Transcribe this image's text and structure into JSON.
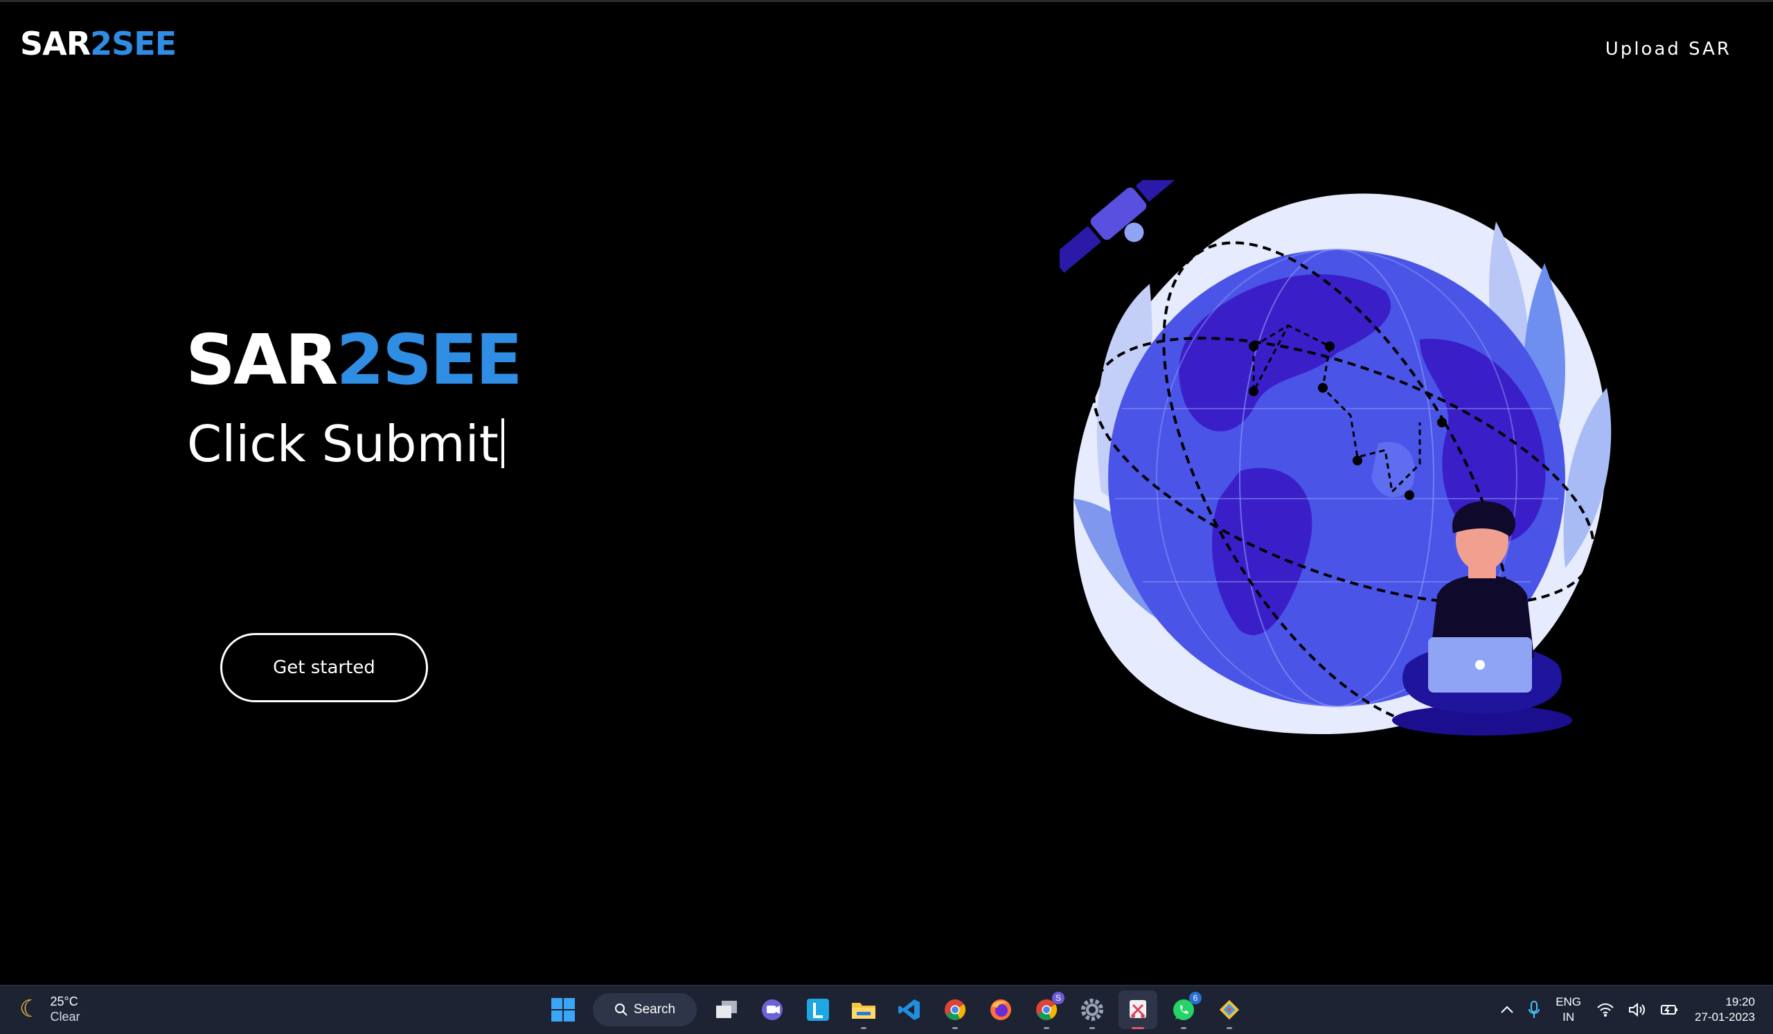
{
  "header": {
    "logo_white": "SAR",
    "logo_blue": "2SEE",
    "nav_upload": "Upload SAR"
  },
  "hero": {
    "title_white": "SAR",
    "title_blue": "2SEE",
    "typed_text": "Click Submit",
    "cta_label": "Get started"
  },
  "colors": {
    "accent_blue": "#2f8de4",
    "background": "#000000",
    "globe_primary": "#4a55e8",
    "globe_dark": "#3a1fc9"
  },
  "taskbar": {
    "weather_temp": "25°C",
    "weather_desc": "Clear",
    "search_label": "Search",
    "apps": [
      {
        "name": "task-view-icon"
      },
      {
        "name": "teams-icon"
      },
      {
        "name": "l-app-icon",
        "label": "L"
      },
      {
        "name": "file-explorer-icon"
      },
      {
        "name": "vscode-icon"
      },
      {
        "name": "chrome-icon"
      },
      {
        "name": "firefox-icon"
      },
      {
        "name": "chrome-profile-icon",
        "badge": "S"
      },
      {
        "name": "settings-icon"
      },
      {
        "name": "snipping-tool-icon"
      },
      {
        "name": "whatsapp-icon",
        "badge": "6"
      },
      {
        "name": "git-icon"
      }
    ],
    "lang_top": "ENG",
    "lang_bottom": "IN",
    "time": "19:20",
    "date": "27-01-2023"
  }
}
